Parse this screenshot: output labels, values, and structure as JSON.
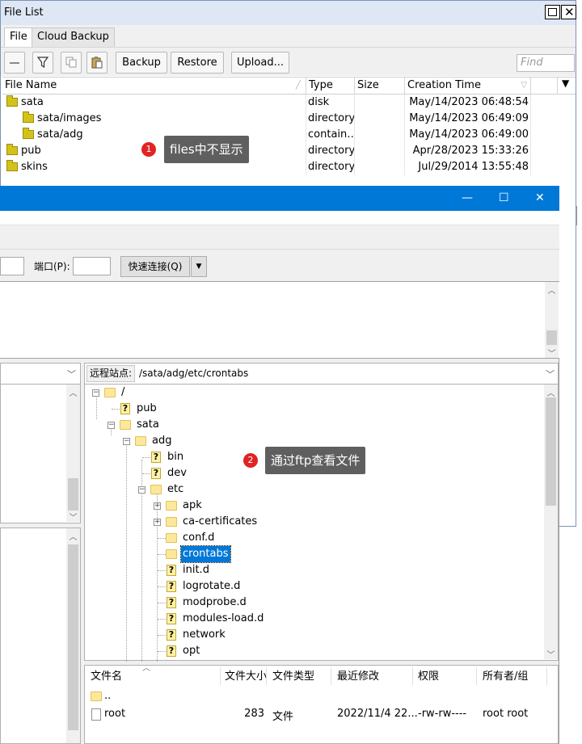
{
  "file_list_window": {
    "title": "File List",
    "tabs": [
      {
        "label": "File"
      },
      {
        "label": "Cloud Backup"
      }
    ],
    "toolbar": {
      "backup_label": "Backup",
      "restore_label": "Restore",
      "upload_label": "Upload...",
      "find_placeholder": "Find"
    },
    "columns": [
      "File Name",
      "Type",
      "Size",
      "Creation Time"
    ],
    "rows": [
      {
        "name": "sata",
        "type": "disk",
        "size": "",
        "created": "May/14/2023 06:48:54"
      },
      {
        "name": "sata/images",
        "type": "directory",
        "size": "",
        "created": "May/14/2023 06:49:09"
      },
      {
        "name": "sata/adg",
        "type": "contain…",
        "size": "",
        "created": "May/14/2023 06:49:00"
      },
      {
        "name": "pub",
        "type": "directory",
        "size": "",
        "created": "Apr/28/2023 15:33:26"
      },
      {
        "name": "skins",
        "type": "directory",
        "size": "",
        "created": "Jul/29/2014 13:55:48"
      }
    ]
  },
  "annotations": [
    {
      "number": "1",
      "text": "files中不显示"
    },
    {
      "number": "2",
      "text": "通过ftp查看文件"
    }
  ],
  "ftp_window": {
    "port_label": "端口(P):",
    "quickconnect_label": "快速连接(Q)",
    "remote_site_label": "远程站点:",
    "remote_path": "/sata/adg/etc/crontabs",
    "tree": [
      {
        "label": "/",
        "depth": 0,
        "icon": "folder",
        "expander": "minus"
      },
      {
        "label": "pub",
        "depth": 1,
        "icon": "unknown",
        "expander": "none"
      },
      {
        "label": "sata",
        "depth": 1,
        "icon": "folder",
        "expander": "minus"
      },
      {
        "label": "adg",
        "depth": 2,
        "icon": "folder",
        "expander": "minus"
      },
      {
        "label": "bin",
        "depth": 3,
        "icon": "unknown",
        "expander": "none"
      },
      {
        "label": "dev",
        "depth": 3,
        "icon": "unknown",
        "expander": "none"
      },
      {
        "label": "etc",
        "depth": 3,
        "icon": "folder",
        "expander": "minus"
      },
      {
        "label": "apk",
        "depth": 4,
        "icon": "folder",
        "expander": "plus"
      },
      {
        "label": "ca-certificates",
        "depth": 4,
        "icon": "folder",
        "expander": "plus"
      },
      {
        "label": "conf.d",
        "depth": 4,
        "icon": "folder",
        "expander": "none"
      },
      {
        "label": "crontabs",
        "depth": 4,
        "icon": "folder",
        "expander": "none",
        "selected": true
      },
      {
        "label": "init.d",
        "depth": 4,
        "icon": "unknown",
        "expander": "none"
      },
      {
        "label": "logrotate.d",
        "depth": 4,
        "icon": "unknown",
        "expander": "none"
      },
      {
        "label": "modprobe.d",
        "depth": 4,
        "icon": "unknown",
        "expander": "none"
      },
      {
        "label": "modules-load.d",
        "depth": 4,
        "icon": "unknown",
        "expander": "none"
      },
      {
        "label": "network",
        "depth": 4,
        "icon": "unknown",
        "expander": "none"
      },
      {
        "label": "opt",
        "depth": 4,
        "icon": "unknown",
        "expander": "none"
      }
    ],
    "list_columns": [
      "文件名",
      "文件大小",
      "文件类型",
      "最近修改",
      "权限",
      "所有者/组"
    ],
    "list_rows": [
      {
        "name": "..",
        "size": "",
        "type": "",
        "modified": "",
        "perms": "",
        "owner": ""
      },
      {
        "name": "root",
        "size": "283",
        "type": "文件",
        "modified": "2022/11/4 22...",
        "perms": "-rw-rw----",
        "owner": "root root"
      }
    ]
  },
  "colors": {
    "accent": "#0078d7",
    "selection": "#0078d7",
    "badge": "#e02424",
    "callout": "#5f5f5f",
    "folder": "#d4c21a"
  }
}
